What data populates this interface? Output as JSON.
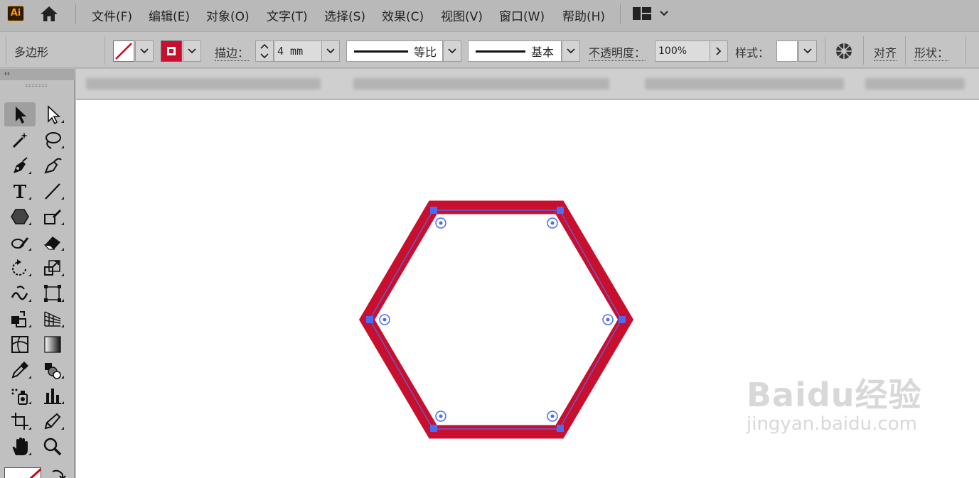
{
  "app": {
    "logo_text": "Ai",
    "home_icon": "home-icon",
    "workspace_icon": "workspace-layout-icon"
  },
  "menu": {
    "items": [
      "文件(F)",
      "编辑(E)",
      "对象(O)",
      "文字(T)",
      "选择(S)",
      "效果(C)",
      "视图(V)",
      "窗口(W)",
      "帮助(H)"
    ]
  },
  "controlbar": {
    "object_type": "多边形",
    "stroke_label": "描边：",
    "stroke_weight": "4 mm",
    "profile_label": "等比",
    "brush_label": "基本",
    "opacity_label": "不透明度：",
    "opacity_value": "100%",
    "style_label": "样式：",
    "align_label": "对齐",
    "shape_label": "形状：",
    "stroke_color": "#c8102e",
    "fill": "none"
  },
  "toolbar": {
    "collapse_glyph": "‹‹",
    "tools": [
      "selection-tool",
      "direct-selection-tool",
      "magic-wand-tool",
      "lasso-tool",
      "pen-tool",
      "curvature-tool",
      "type-tool",
      "line-segment-tool",
      "polygon-tool",
      "shaper-tool",
      "paintbrush-tool",
      "eraser-tool",
      "rotate-tool",
      "scale-tool",
      "warp-tool",
      "free-transform-tool",
      "shape-builder-tool",
      "perspective-grid-tool",
      "mesh-tool",
      "gradient-tool",
      "eyedropper-tool",
      "blend-tool",
      "symbol-sprayer-tool",
      "column-graph-tool",
      "artboard-tool",
      "slice-tool",
      "hand-tool",
      "zoom-tool"
    ]
  },
  "canvas": {
    "shape": "hexagon",
    "stroke_color": "#c8102e",
    "selection_color": "#4a6cf7"
  },
  "watermark": {
    "line1": "Baidu经验",
    "line2": "jingyan.baidu.com"
  }
}
